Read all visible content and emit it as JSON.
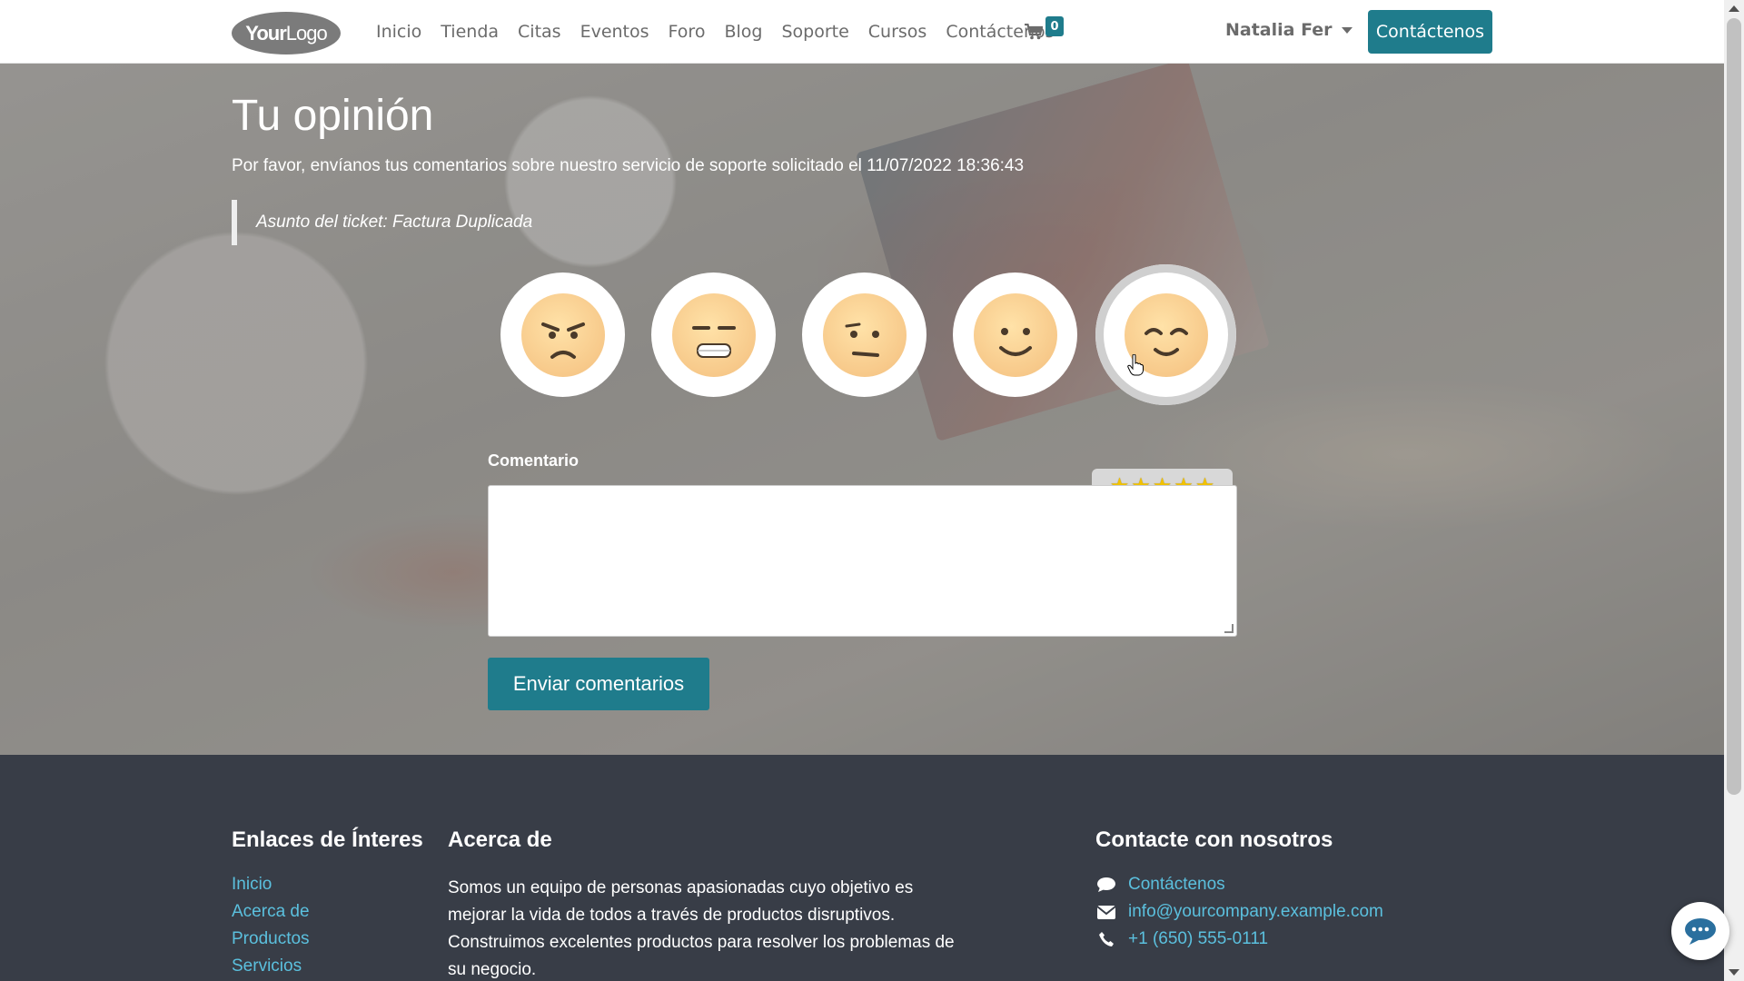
{
  "nav": {
    "logo_bold": "Your",
    "logo_rest": "Logo",
    "links": [
      "Inicio",
      "Tienda",
      "Citas",
      "Eventos",
      "Foro",
      "Blog",
      "Soporte",
      "Cursos",
      "Contáctenos"
    ],
    "cart_count": "0",
    "user_name": "Natalia Fer",
    "cta_label": "Contáctenos"
  },
  "hero": {
    "title": "Tu opinión",
    "subtitle": "Por favor, envíanos tus comentarios sobre nuestro servicio de soporte solicitado el 11/07/2022 18:36:43",
    "ticket_subject": "Asunto del ticket: Factura Duplicada",
    "rating": {
      "faces": [
        "angry-face-icon",
        "grimacing-face-icon",
        "neutral-face-icon",
        "slightly-smiling-face-icon",
        "happy-face-icon"
      ],
      "selected_index": 4,
      "stars": 5
    },
    "comment_label": "Comentario",
    "comment_value": "",
    "submit_label": "Enviar comentarios"
  },
  "footer": {
    "links_title": "Enlaces de Ínteres",
    "links": [
      "Inicio",
      "Acerca de",
      "Productos",
      "Servicios"
    ],
    "about_title": "Acerca de",
    "about_text": "Somos un equipo de personas apasionadas cuyo objetivo es mejorar la vida de todos a través de productos disruptivos. Construimos excelentes productos para resolver los problemas de su negocio.",
    "contact_title": "Contacte con nosotros",
    "contact": {
      "contact_link": "Contáctenos",
      "email": "info@yourcompany.example.com",
      "phone": "+1 (650) 555-0111"
    }
  },
  "colors": {
    "primary": "#1f7c8c",
    "footer_bg": "#383d47",
    "link": "#5bc0de",
    "star": "#f2c200"
  }
}
